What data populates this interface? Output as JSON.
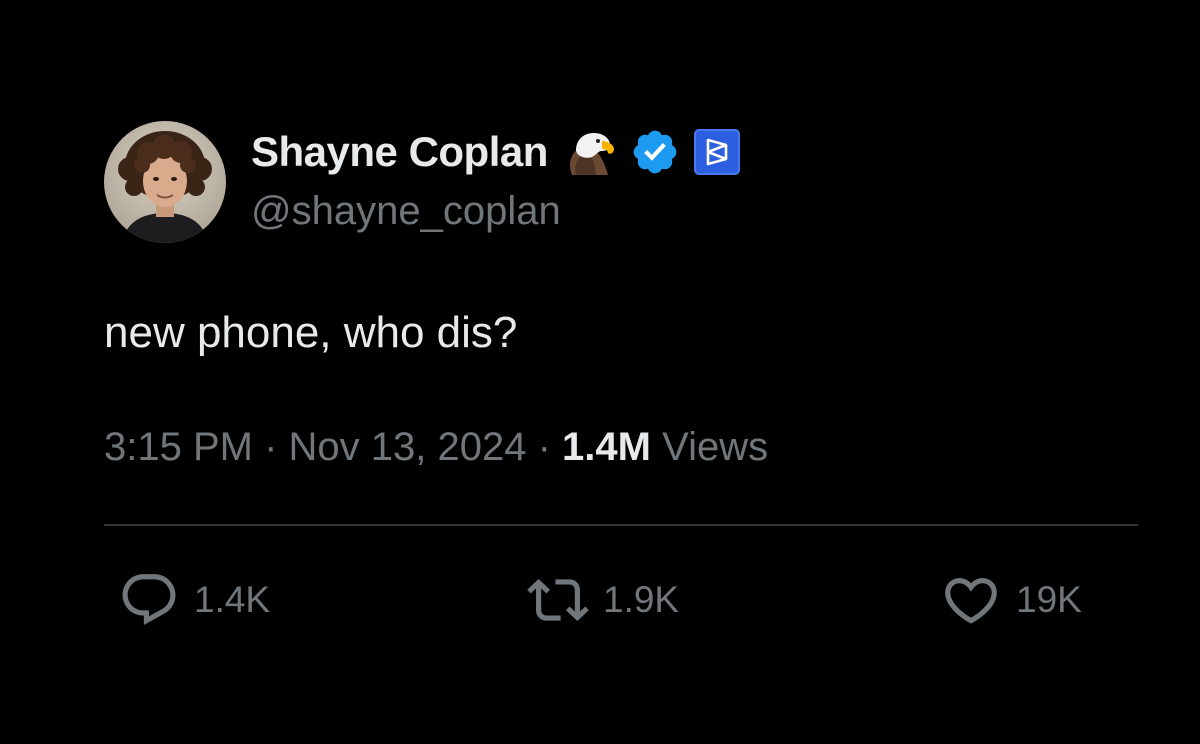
{
  "author": {
    "display_name": "Shayne Coplan",
    "handle": "@shayne_coplan",
    "emoji": "eagle-icon",
    "verified_badge": "verified-badge-icon",
    "affiliate_badge": "polymarket-affiliate-icon"
  },
  "tweet": {
    "text": "new phone, who dis?"
  },
  "meta": {
    "time": "3:15 PM",
    "separator": "·",
    "date": "Nov 13, 2024",
    "views_count": "1.4M",
    "views_label": "Views"
  },
  "actions": {
    "reply_count": "1.4K",
    "retweet_count": "1.9K",
    "like_count": "19K"
  },
  "colors": {
    "background": "#000000",
    "primary_text": "#e7e9ea",
    "secondary_text": "#71767b",
    "verified_blue": "#1d9bf0",
    "affiliate_blue": "#2b5fe0",
    "divider": "#2f3336"
  }
}
